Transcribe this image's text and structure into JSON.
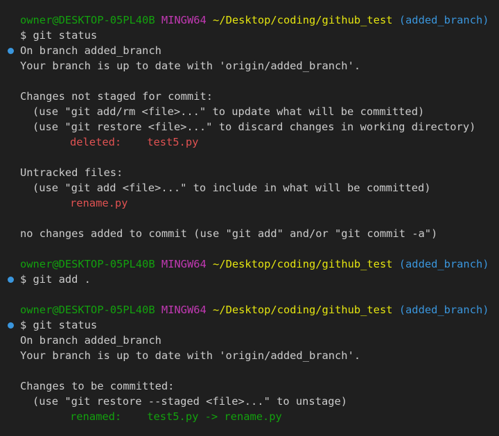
{
  "prompt": {
    "user_host": "owner@DESKTOP-05PL40B",
    "shell": "MINGW64",
    "path": "~/Desktop/coding/github_test",
    "branch": "(added_branch)"
  },
  "block1": {
    "command": "$ git status",
    "branch_line": "On branch added_branch",
    "upstream_line": "Your branch is up to date with 'origin/added_branch'.",
    "unstaged_header": "Changes not staged for commit:",
    "unstaged_hint1": "(use \"git add/rm <file>...\" to update what will be committed)",
    "unstaged_hint2": "(use \"git restore <file>...\" to discard changes in working directory)",
    "deleted_label": "deleted:",
    "deleted_file": "test5.py",
    "untracked_header": "Untracked files:",
    "untracked_hint": "(use \"git add <file>...\" to include in what will be committed)",
    "untracked_file": "rename.py",
    "summary": "no changes added to commit (use \"git add\" and/or \"git commit -a\")"
  },
  "block2": {
    "command": "$ git add ."
  },
  "block3": {
    "command": "$ git status",
    "branch_line": "On branch added_branch",
    "upstream_line": "Your branch is up to date with 'origin/added_branch'.",
    "staged_header": "Changes to be committed:",
    "staged_hint": "(use \"git restore --staged <file>...\" to unstage)",
    "renamed_label": "renamed:",
    "renamed_change": "test5.py -> rename.py"
  },
  "colors": {
    "background": "#1f1f1f",
    "foreground": "#cccccc",
    "user_host": "#13a10e",
    "shell": "#c239b3",
    "path": "#e5e510",
    "branch": "#3a96dd",
    "deleted": "#e05252",
    "renamed": "#13a10e",
    "command_marker": "#3a96dd"
  }
}
